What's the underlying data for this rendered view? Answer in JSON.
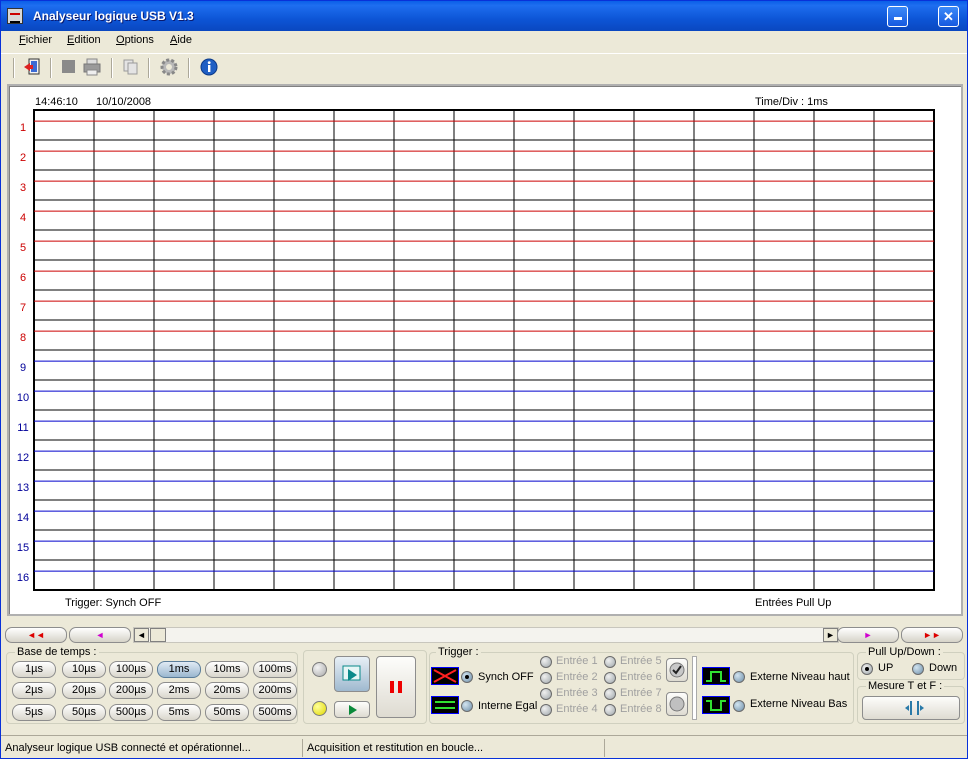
{
  "window": {
    "title": "Analyseur logique USB V1.3"
  },
  "menu": [
    "Fichier",
    "Edition",
    "Options",
    "Aide"
  ],
  "toolbar_icons": [
    "exit-icon",
    "stop-icon",
    "print-icon",
    "copy-icon",
    "settings-icon",
    "info-icon"
  ],
  "graph": {
    "time": "14:46:10",
    "date": "10/10/2008",
    "time_div": "Time/Div : 1ms",
    "trigger_status": "Trigger: Synch OFF",
    "inputs_status": "Entrées Pull Up",
    "channels": [
      "1",
      "2",
      "3",
      "4",
      "5",
      "6",
      "7",
      "8",
      "9",
      "10",
      "11",
      "12",
      "13",
      "14",
      "15",
      "16"
    ],
    "colors": {
      "group1": "#cc0000",
      "group2": "#000099",
      "grid": "#000000",
      "trace_red": "#cc0000",
      "trace_blue": "#0000cc"
    }
  },
  "nav": {
    "first": "◄◄",
    "prev": "◄",
    "next": "►",
    "last": "►►"
  },
  "timebase": {
    "label": "Base de temps :",
    "rows": [
      [
        "1µs",
        "10µs",
        "100µs",
        "1ms",
        "10ms",
        "100ms"
      ],
      [
        "2µs",
        "20µs",
        "200µs",
        "2ms",
        "20ms",
        "200ms"
      ],
      [
        "5µs",
        "50µs",
        "500µs",
        "5ms",
        "50ms",
        "500ms"
      ]
    ],
    "selected": "1ms"
  },
  "trigger": {
    "label": "Trigger :",
    "synch_off": "Synch OFF",
    "interne_egal": "Interne Egal",
    "inputs_left": [
      "Entrée 1",
      "Entrée 2",
      "Entrée 3",
      "Entrée 4"
    ],
    "inputs_right": [
      "Entrée 5",
      "Entrée 6",
      "Entrée 7",
      "Entrée 8"
    ],
    "ext_high": "Externe Niveau haut",
    "ext_low": "Externe Niveau Bas"
  },
  "pull": {
    "label": "Pull Up/Down :",
    "up": "UP",
    "down": "Down"
  },
  "mesure": {
    "label": "Mesure T et F :"
  },
  "status": {
    "left": "Analyseur logique USB connecté et opérationnel...",
    "mid": "Acquisition et restitution en boucle..."
  }
}
